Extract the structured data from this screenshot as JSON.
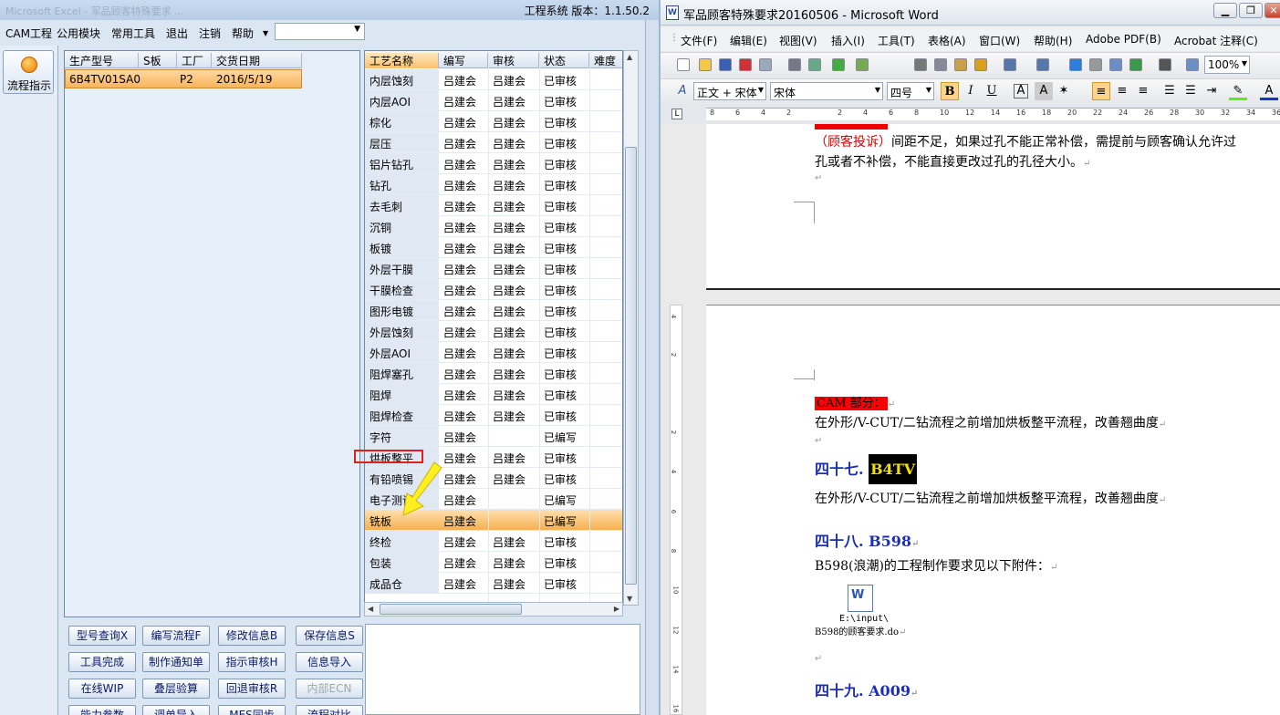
{
  "cam": {
    "title_ghost": "Microsoft Excel - 军品顾客特殊要求 ...",
    "version_label": "工程系统   版本：1.1.50.2",
    "menu": [
      "CAM工程",
      "公用模块",
      "常用工具",
      "退出",
      "注销",
      "帮助"
    ],
    "left_button": "流程指示",
    "grid1": {
      "headers": [
        "生产型号",
        "S板",
        "工厂",
        "交货日期"
      ],
      "row": [
        "6B4TV01SA0",
        "",
        "P2",
        "2016/5/19"
      ]
    },
    "grid2": {
      "headers": [
        "工艺名称",
        "编写",
        "审核",
        "状态",
        "难度"
      ],
      "rows": [
        [
          "内层蚀刻",
          "吕建会",
          "吕建会",
          "已审核"
        ],
        [
          "内层AOI",
          "吕建会",
          "吕建会",
          "已审核"
        ],
        [
          "棕化",
          "吕建会",
          "吕建会",
          "已审核"
        ],
        [
          "层压",
          "吕建会",
          "吕建会",
          "已审核"
        ],
        [
          "铝片钻孔",
          "吕建会",
          "吕建会",
          "已审核"
        ],
        [
          "钻孔",
          "吕建会",
          "吕建会",
          "已审核"
        ],
        [
          "去毛刺",
          "吕建会",
          "吕建会",
          "已审核"
        ],
        [
          "沉铜",
          "吕建会",
          "吕建会",
          "已审核"
        ],
        [
          "板镀",
          "吕建会",
          "吕建会",
          "已审核"
        ],
        [
          "外层干膜",
          "吕建会",
          "吕建会",
          "已审核"
        ],
        [
          "干膜检查",
          "吕建会",
          "吕建会",
          "已审核"
        ],
        [
          "图形电镀",
          "吕建会",
          "吕建会",
          "已审核"
        ],
        [
          "外层蚀刻",
          "吕建会",
          "吕建会",
          "已审核"
        ],
        [
          "外层AOI",
          "吕建会",
          "吕建会",
          "已审核"
        ],
        [
          "阻焊塞孔",
          "吕建会",
          "吕建会",
          "已审核"
        ],
        [
          "阻焊",
          "吕建会",
          "吕建会",
          "已审核"
        ],
        [
          "阻焊检查",
          "吕建会",
          "吕建会",
          "已审核"
        ],
        [
          "字符",
          "吕建会",
          "",
          "已编写"
        ],
        [
          "烘板整平",
          "吕建会",
          "吕建会",
          "已审核"
        ],
        [
          "有铅喷锡",
          "吕建会",
          "吕建会",
          "已审核"
        ],
        [
          "电子测试",
          "吕建会",
          "",
          "已编写"
        ],
        [
          "铣板",
          "吕建会",
          "",
          "已编写"
        ],
        [
          "终检",
          "吕建会",
          "吕建会",
          "已审核"
        ],
        [
          "包装",
          "吕建会",
          "吕建会",
          "已审核"
        ],
        [
          "成品仓",
          "吕建会",
          "吕建会",
          "已审核"
        ]
      ],
      "selected_index": 21,
      "highlighted_item": "烘板整平"
    },
    "buttons": [
      [
        "型号查询X",
        "编写流程F",
        "修改信息B",
        "保存信息S"
      ],
      [
        "工具完成",
        "制作通知单",
        "指示审核H",
        "信息导入"
      ],
      [
        "在线WIP",
        "叠层验算",
        "回退审核R",
        "内部ECN"
      ],
      [
        "能力参数",
        "调单导入",
        "MES同步",
        "流程对比"
      ]
    ]
  },
  "word": {
    "title": "军品顾客特殊要求20160506 - Microsoft Word",
    "menu": [
      "文件(F)",
      "编辑(E)",
      "视图(V)",
      "插入(I)",
      "工具(T)",
      "表格(A)",
      "窗口(W)",
      "帮助(H)",
      "Adobe PDF(B)",
      "Acrobat 注释(C)"
    ],
    "zoom": "100%",
    "style": "正文 + 宋体",
    "font": "宋体",
    "size": "四号",
    "ruler_nums": [
      "8",
      "6",
      "4",
      "2",
      "2",
      "4",
      "6",
      "8",
      "10",
      "12",
      "14",
      "16",
      "18",
      "20",
      "22",
      "24",
      "26",
      "28",
      "30",
      "32",
      "34",
      "36"
    ],
    "vruler_nums": [
      "4",
      "2",
      "2",
      "4",
      "6",
      "8",
      "10",
      "12",
      "14",
      "16"
    ],
    "page1": {
      "line1_red": "（顾客投诉）",
      "line1_rest": "间距不足，如果过孔不能正常补偿，需提前与顾客确认允许过",
      "line2": "孔或者不补偿，不能直接更改过孔的孔径大小。"
    },
    "page2": {
      "cam_part": "CAM 部分：",
      "p1": "在外形/V-CUT/二钻流程之前增加烘板整平流程，改善翘曲度",
      "h47_num": "四十七.",
      "h47_tag": "B4TV",
      "p2": "在外形/V-CUT/二钻流程之前增加烘板整平流程，改善翘曲度",
      "h48": "四十八. B598",
      "p3": "B598(浪潮)的工程制作要求见以下附件：",
      "attach_path": "E:\\input\\",
      "attach_name": "B598的顾客要求.do",
      "h49": "四十九. A009"
    }
  },
  "colors": {
    "accent_orange": "#f6b050",
    "word_heading": "#1b2fb5",
    "highlight_red": "#ff0000"
  }
}
